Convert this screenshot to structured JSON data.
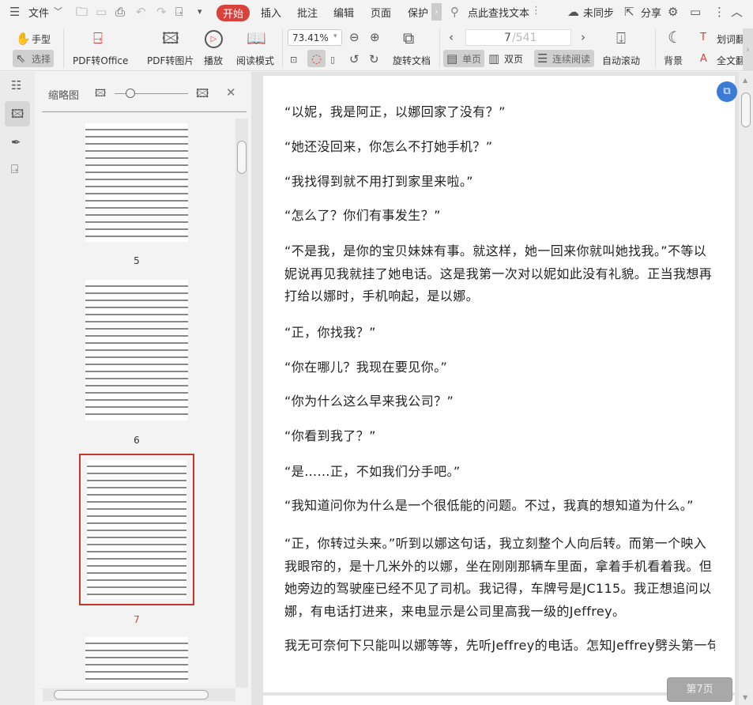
{
  "topbar": {
    "menu": "文件",
    "tabs": [
      "开始",
      "插入",
      "批注",
      "编辑",
      "页面",
      "保护"
    ],
    "search_placeholder": "点此查找文本",
    "sync": "未同步",
    "share": "分享"
  },
  "ribbon": {
    "hand": "手型",
    "select": "选择",
    "pdf_to_office": "PDF转Office",
    "pdf_to_image": "PDF转图片",
    "play": "播放",
    "read_mode": "阅读模式",
    "zoom": "73.41%",
    "rotate_doc": "旋转文档",
    "page_current": "7",
    "page_total": "/541",
    "single": "单页",
    "double": "双页",
    "continuous": "连续阅读",
    "auto_scroll": "自动滚动",
    "background": "背景",
    "word_translate": "划词翻",
    "full_translate": "全文翻"
  },
  "thumbnails": {
    "title": "缩略图",
    "pages": [
      "5",
      "6",
      "7"
    ],
    "current": "7"
  },
  "document": {
    "paragraphs": [
      "“以妮，我是阿正，以娜回家了没有？”",
      "“她还没回来，你怎么不打她手机？”",
      "“我找得到就不用打到家里来啦。”",
      "“怎么了？你们有事发生？”",
      "“不是我，是你的宝贝妹妹有事。就这样，她一回来你就叫她找我。”不等以妮说再见我就挂了她电话。这是我第一次对以妮如此没有礼貌。正当我想再打给以娜时，手机响起，是以娜。",
      "“正，你找我？”",
      "“你在哪儿？我现在要见你。”",
      "“你为什么这么早来我公司？”",
      "“你看到我了？”",
      "“是……正，不如我们分手吧。”",
      "“我知道问你为什么是一个很低能的问题。不过，我真的想知道为什么。”",
      "“正，你转过头来。”听到以娜这句话，我立刻整个人向后转。而第一个映入我眼帘的，是十几米外的以娜，坐在刚刚那辆车里面，拿着手机看着我。但她旁边的驾驶座已经不见了司机。我记得，车牌号是JC115。我正想追问以娜，有电话打进来，来电显示是公司里高我一级的Jeffrey。",
      "我无可奈何下只能叫以娜等等，先听Jeffrey的电话。怎知Jeffrey劈头第一句话竟"
    ],
    "page_badge": "第7页"
  },
  "colors": {
    "accent": "#d9413c",
    "current_thumb": "#c0392b",
    "blue_badge": "#3a7bd5"
  }
}
